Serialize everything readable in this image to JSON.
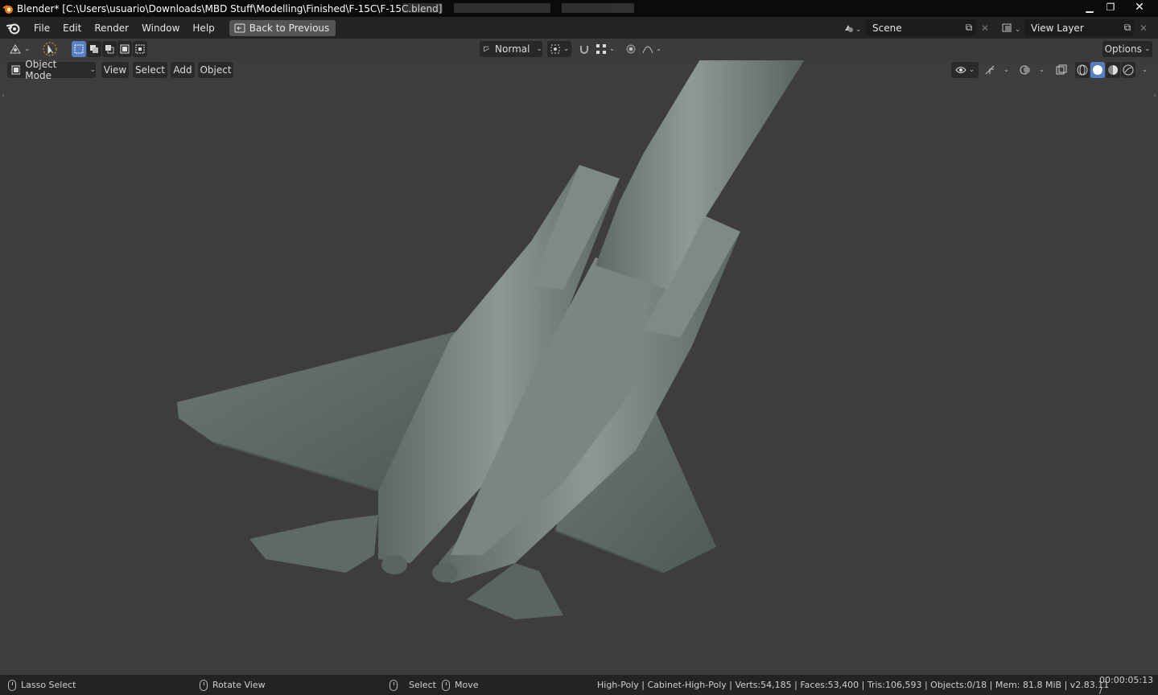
{
  "window": {
    "title": "Blender* [C:\\Users\\usuario\\Downloads\\MBD Stuff\\Modelling\\Finished\\F-15C\\F-15C.blend]",
    "minimize": "▁",
    "restore": "❐",
    "close": "✕"
  },
  "topbar": {
    "menus": [
      "File",
      "Edit",
      "Render",
      "Window",
      "Help"
    ],
    "back_label": "Back to Previous",
    "scene": "Scene",
    "view_layer": "View Layer"
  },
  "toolbar": {
    "orientation": "Normal",
    "options": "Options"
  },
  "viewport_header": {
    "mode": "Object Mode",
    "menus": [
      "View",
      "Select",
      "Add",
      "Object"
    ]
  },
  "statusbar": {
    "lasso": "Lasso Select",
    "rotate": "Rotate View",
    "select": "Select",
    "move": "Move",
    "stats": "High-Poly | Cabinet-High-Poly | Verts:54,185 | Faces:53,400 | Tris:106,593 | Objects:0/18 | Mem: 81.8 MiB | v2.83.11",
    "time": "00:00:05:13 /"
  },
  "colors": {
    "viewport_bg": "#3d3d3d",
    "header_bg": "#232323",
    "accent_blue": "#5680c2",
    "model": "#6f7a78"
  }
}
